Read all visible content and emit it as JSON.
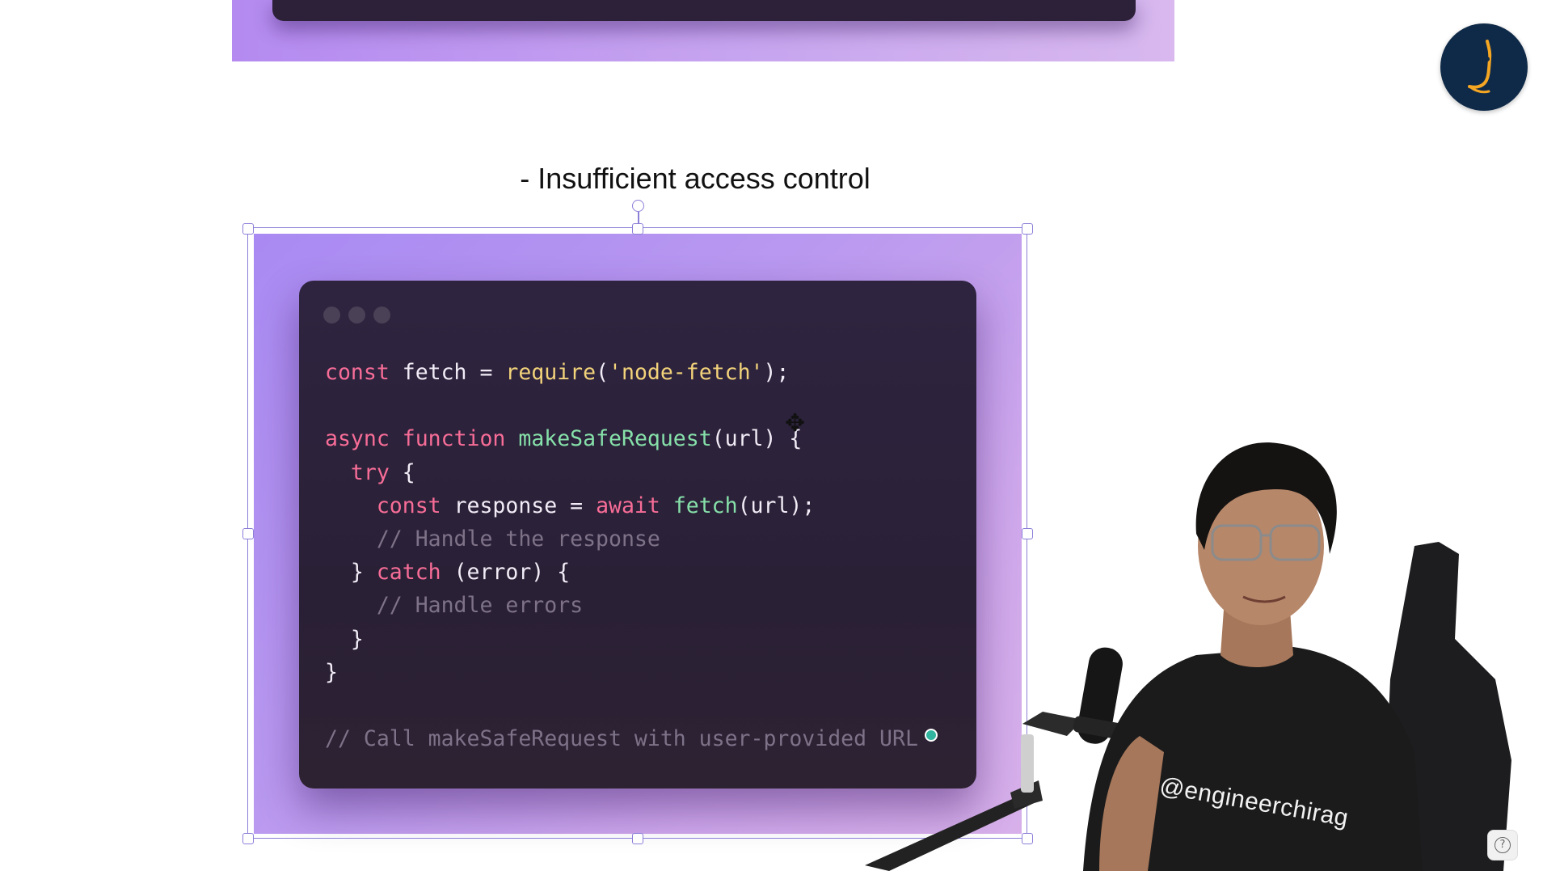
{
  "heading": "- Insufficient access control",
  "code": {
    "lines": [
      [
        [
          "kw",
          "const"
        ],
        [
          "pl",
          " fetch = "
        ],
        [
          "call",
          "require"
        ],
        [
          "pl",
          "("
        ],
        [
          "str",
          "'node-fetch'"
        ],
        [
          "pl",
          ");"
        ]
      ],
      [],
      [
        [
          "kw",
          "async"
        ],
        [
          "pl",
          " "
        ],
        [
          "kw",
          "function"
        ],
        [
          "pl",
          " "
        ],
        [
          "fn",
          "makeSafeRequest"
        ],
        [
          "pl",
          "(url) {"
        ]
      ],
      [
        [
          "pl",
          "  "
        ],
        [
          "kw",
          "try"
        ],
        [
          "pl",
          " {"
        ]
      ],
      [
        [
          "pl",
          "    "
        ],
        [
          "kw",
          "const"
        ],
        [
          "pl",
          " response = "
        ],
        [
          "kw",
          "await"
        ],
        [
          "pl",
          " "
        ],
        [
          "fn",
          "fetch"
        ],
        [
          "pl",
          "(url);"
        ]
      ],
      [
        [
          "pl",
          "    "
        ],
        [
          "cm",
          "// Handle the response"
        ]
      ],
      [
        [
          "pl",
          "  } "
        ],
        [
          "kw",
          "catch"
        ],
        [
          "pl",
          " (error) {"
        ]
      ],
      [
        [
          "pl",
          "    "
        ],
        [
          "cm",
          "// Handle errors"
        ]
      ],
      [
        [
          "pl",
          "  }"
        ]
      ],
      [
        [
          "pl",
          "}"
        ]
      ],
      [],
      [
        [
          "cm",
          "// Call makeSafeRequest with user-provided URL"
        ]
      ]
    ]
  },
  "presenter": {
    "shirt_text": "@engineerchirag"
  },
  "help_label": "?",
  "colors": {
    "slide_gradient_start": "#a98af2",
    "slide_gradient_end": "#d7b0ea",
    "window_bg": "#2a2036",
    "keyword": "#f76d97",
    "function": "#86e0a9",
    "string": "#f3d37a",
    "comment": "#7d7288",
    "selection": "#8b7fd8",
    "logo_bg": "#0f2a48",
    "logo_accent": "#f5a623"
  },
  "icons": {
    "logo": "brand-logo-icon",
    "move_cursor": "move-cursor-icon",
    "help": "help-icon"
  }
}
